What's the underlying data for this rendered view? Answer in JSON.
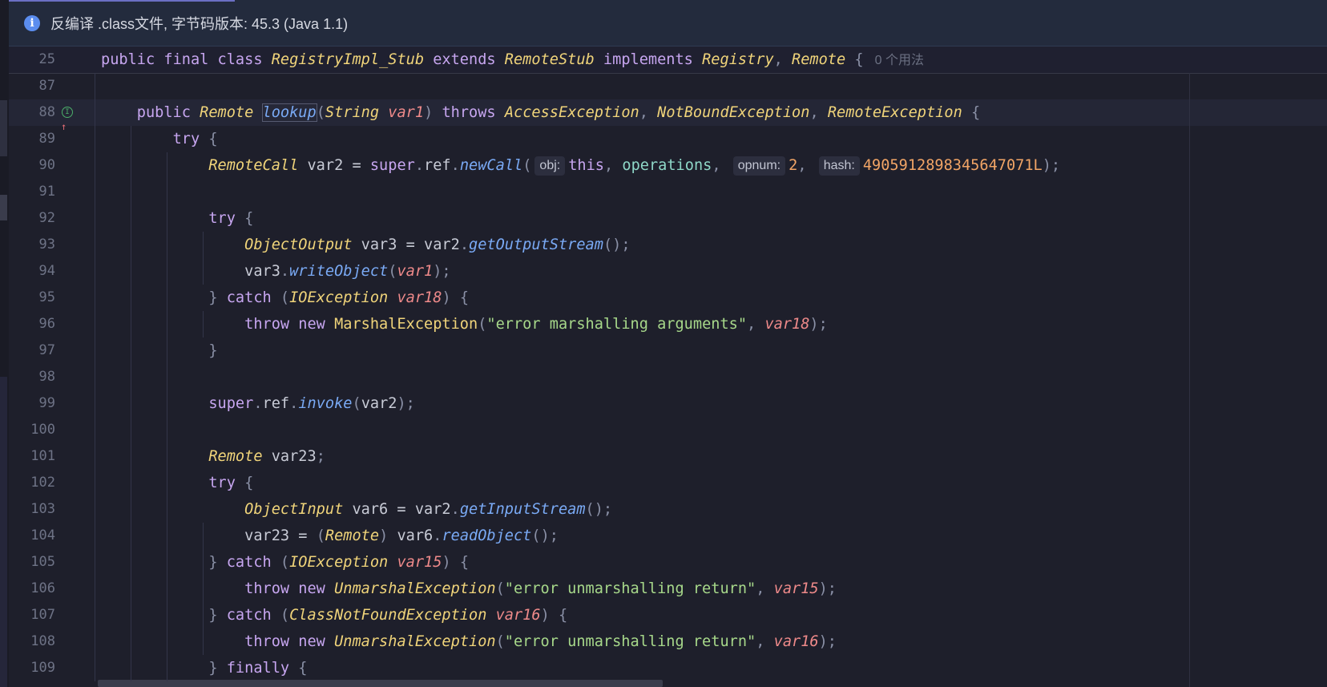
{
  "banner": {
    "icon": "info-icon",
    "text": "反编译 .class文件, 字节码版本: 45.3 (Java 1.1)"
  },
  "editor": {
    "usage_hint": "0 个用法",
    "lines": [
      {
        "n": "25",
        "tokens": [
          [
            "kw",
            "public "
          ],
          [
            "kw",
            "final "
          ],
          [
            "kw",
            "class "
          ],
          [
            "ty",
            "RegistryImpl_Stub"
          ],
          [
            "kw",
            " extends "
          ],
          [
            "ty",
            "RemoteStub"
          ],
          [
            "kw",
            " implements "
          ],
          [
            "ty",
            "Registry"
          ],
          [
            "pn",
            ", "
          ],
          [
            "ty",
            "Remote"
          ],
          [
            "pn",
            " {"
          ]
        ]
      },
      {
        "n": "87",
        "tokens": []
      },
      {
        "n": "88",
        "tokens": [
          [
            "sp",
            "    "
          ],
          [
            "kw",
            "public "
          ],
          [
            "ty",
            "Remote "
          ],
          [
            "fnhl",
            "lookup"
          ],
          [
            "pn",
            "("
          ],
          [
            "ty",
            "String "
          ],
          [
            "pa",
            "var1"
          ],
          [
            "pn",
            ") "
          ],
          [
            "kw",
            "throws "
          ],
          [
            "ty",
            "AccessException"
          ],
          [
            "pn",
            ", "
          ],
          [
            "ty",
            "NotBoundException"
          ],
          [
            "pn",
            ", "
          ],
          [
            "ty",
            "RemoteException"
          ],
          [
            "pn",
            " {"
          ]
        ]
      },
      {
        "n": "89",
        "tokens": [
          [
            "sp",
            "        "
          ],
          [
            "kw",
            "try "
          ],
          [
            "pn",
            "{"
          ]
        ]
      },
      {
        "n": "90",
        "tokens": [
          [
            "sp",
            "            "
          ],
          [
            "ty",
            "RemoteCall"
          ],
          [
            "tx",
            " var2 = "
          ],
          [
            "kw",
            "super"
          ],
          [
            "pn",
            "."
          ],
          [
            "tx",
            "ref"
          ],
          [
            "pn",
            "."
          ],
          [
            "fn",
            "newCall"
          ],
          [
            "pn",
            "("
          ],
          [
            "hint",
            "obj:"
          ],
          [
            "kw",
            "this"
          ],
          [
            "pn",
            ", "
          ],
          [
            "fld",
            "operations"
          ],
          [
            "pn",
            ", "
          ],
          [
            "hint",
            "opnum:"
          ],
          [
            "nu",
            "2"
          ],
          [
            "pn",
            ", "
          ],
          [
            "hint",
            "hash:"
          ],
          [
            "nu",
            "4905912898345647071L"
          ],
          [
            "pn",
            ");"
          ]
        ]
      },
      {
        "n": "91",
        "tokens": []
      },
      {
        "n": "92",
        "tokens": [
          [
            "sp",
            "            "
          ],
          [
            "kw",
            "try "
          ],
          [
            "pn",
            "{"
          ]
        ]
      },
      {
        "n": "93",
        "tokens": [
          [
            "sp",
            "                "
          ],
          [
            "ty",
            "ObjectOutput"
          ],
          [
            "tx",
            " var3 = var2"
          ],
          [
            "pn",
            "."
          ],
          [
            "fn",
            "getOutputStream"
          ],
          [
            "pn",
            "();"
          ]
        ]
      },
      {
        "n": "94",
        "tokens": [
          [
            "sp",
            "                "
          ],
          [
            "tx",
            "var3"
          ],
          [
            "pn",
            "."
          ],
          [
            "fn",
            "writeObject"
          ],
          [
            "pn",
            "("
          ],
          [
            "pa",
            "var1"
          ],
          [
            "pn",
            ");"
          ]
        ]
      },
      {
        "n": "95",
        "tokens": [
          [
            "sp",
            "            "
          ],
          [
            "pn",
            "} "
          ],
          [
            "kw",
            "catch "
          ],
          [
            "pn",
            "("
          ],
          [
            "ty",
            "IOException "
          ],
          [
            "pa",
            "var18"
          ],
          [
            "pn",
            ") {"
          ]
        ]
      },
      {
        "n": "96",
        "tokens": [
          [
            "sp",
            "                "
          ],
          [
            "kw",
            "throw new "
          ],
          [
            "tyn",
            "MarshalException"
          ],
          [
            "pn",
            "("
          ],
          [
            "st",
            "\"error marshalling arguments\""
          ],
          [
            "pn",
            ", "
          ],
          [
            "pa",
            "var18"
          ],
          [
            "pn",
            ");"
          ]
        ]
      },
      {
        "n": "97",
        "tokens": [
          [
            "sp",
            "            "
          ],
          [
            "pn",
            "}"
          ]
        ]
      },
      {
        "n": "98",
        "tokens": []
      },
      {
        "n": "99",
        "tokens": [
          [
            "sp",
            "            "
          ],
          [
            "kw",
            "super"
          ],
          [
            "pn",
            "."
          ],
          [
            "tx",
            "ref"
          ],
          [
            "pn",
            "."
          ],
          [
            "fn",
            "invoke"
          ],
          [
            "pn",
            "("
          ],
          [
            "tx",
            "var2"
          ],
          [
            "pn",
            ");"
          ]
        ]
      },
      {
        "n": "100",
        "tokens": []
      },
      {
        "n": "101",
        "tokens": [
          [
            "sp",
            "            "
          ],
          [
            "ty",
            "Remote"
          ],
          [
            "tx",
            " var23"
          ],
          [
            "pn",
            ";"
          ]
        ]
      },
      {
        "n": "102",
        "tokens": [
          [
            "sp",
            "            "
          ],
          [
            "kw",
            "try "
          ],
          [
            "pn",
            "{"
          ]
        ]
      },
      {
        "n": "103",
        "tokens": [
          [
            "sp",
            "                "
          ],
          [
            "ty",
            "ObjectInput"
          ],
          [
            "tx",
            " var6 = var2"
          ],
          [
            "pn",
            "."
          ],
          [
            "fn",
            "getInputStream"
          ],
          [
            "pn",
            "();"
          ]
        ]
      },
      {
        "n": "104",
        "tokens": [
          [
            "sp",
            "                "
          ],
          [
            "tx",
            "var23 = "
          ],
          [
            "pn",
            "("
          ],
          [
            "ty",
            "Remote"
          ],
          [
            "pn",
            ") "
          ],
          [
            "tx",
            "var6"
          ],
          [
            "pn",
            "."
          ],
          [
            "fn",
            "readObject"
          ],
          [
            "pn",
            "();"
          ]
        ]
      },
      {
        "n": "105",
        "tokens": [
          [
            "sp",
            "            "
          ],
          [
            "pn",
            "} "
          ],
          [
            "kw",
            "catch "
          ],
          [
            "pn",
            "("
          ],
          [
            "ty",
            "IOException "
          ],
          [
            "pa",
            "var15"
          ],
          [
            "pn",
            ") {"
          ]
        ]
      },
      {
        "n": "106",
        "tokens": [
          [
            "sp",
            "                "
          ],
          [
            "kw",
            "throw new "
          ],
          [
            "ty",
            "UnmarshalException"
          ],
          [
            "pn",
            "("
          ],
          [
            "st",
            "\"error unmarshalling return\""
          ],
          [
            "pn",
            ", "
          ],
          [
            "pa",
            "var15"
          ],
          [
            "pn",
            ");"
          ]
        ]
      },
      {
        "n": "107",
        "tokens": [
          [
            "sp",
            "            "
          ],
          [
            "pn",
            "} "
          ],
          [
            "kw",
            "catch "
          ],
          [
            "pn",
            "("
          ],
          [
            "ty",
            "ClassNotFoundException "
          ],
          [
            "pa",
            "var16"
          ],
          [
            "pn",
            ") {"
          ]
        ]
      },
      {
        "n": "108",
        "tokens": [
          [
            "sp",
            "                "
          ],
          [
            "kw",
            "throw new "
          ],
          [
            "ty",
            "UnmarshalException"
          ],
          [
            "pn",
            "("
          ],
          [
            "st",
            "\"error unmarshalling return\""
          ],
          [
            "pn",
            ", "
          ],
          [
            "pa",
            "var16"
          ],
          [
            "pn",
            ");"
          ]
        ]
      },
      {
        "n": "109",
        "tokens": [
          [
            "sp",
            "            "
          ],
          [
            "pn",
            "} "
          ],
          [
            "kw",
            "finally "
          ],
          [
            "pn",
            "{"
          ]
        ]
      }
    ]
  }
}
